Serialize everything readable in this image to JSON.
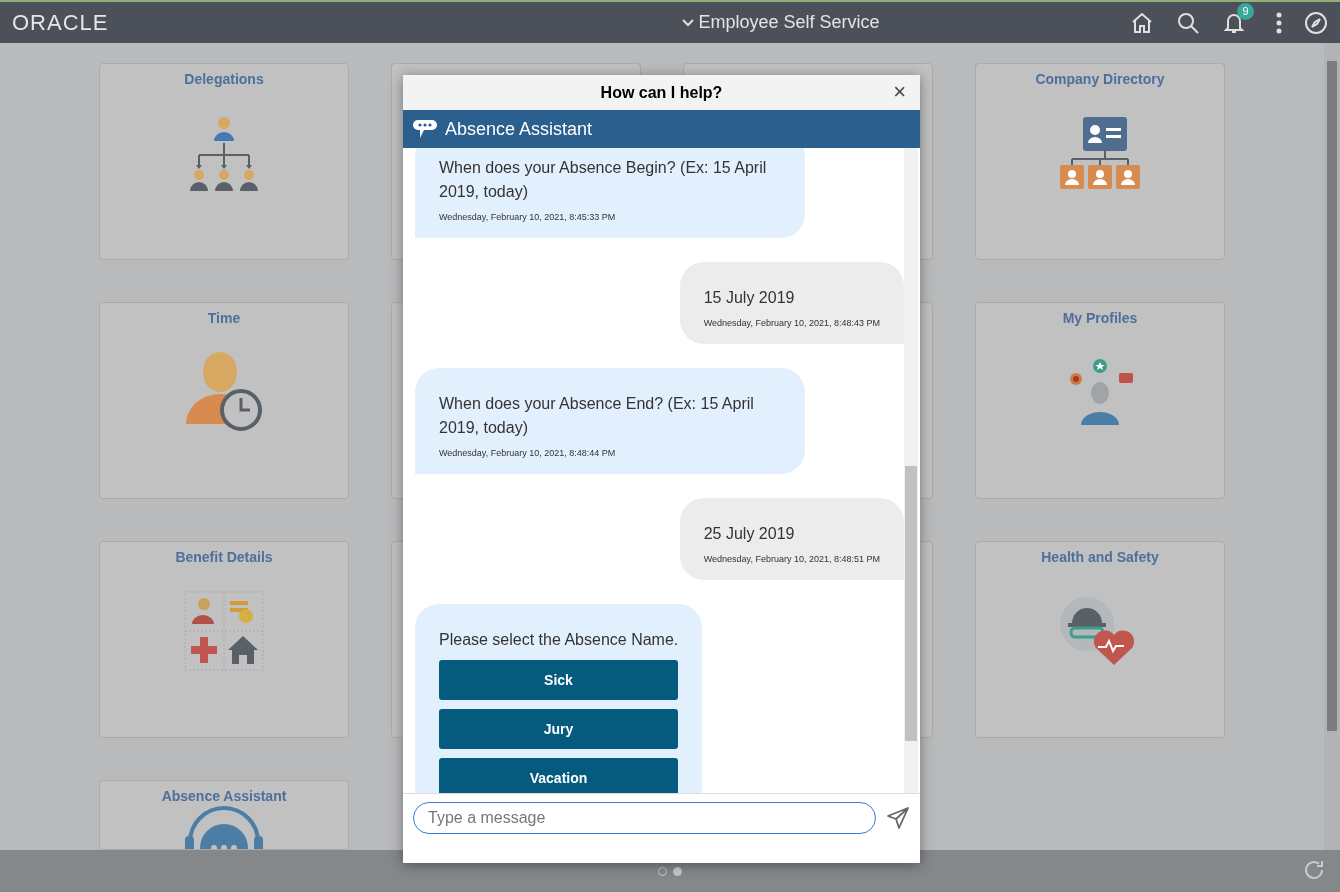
{
  "header": {
    "logo": "ORACLE",
    "title": "Employee Self Service",
    "notification_count": "9"
  },
  "tiles": [
    {
      "kind": "delegations",
      "title": "Delegations"
    },
    {
      "kind": "covered"
    },
    {
      "kind": "covered"
    },
    {
      "kind": "directory",
      "title": "Company Directory"
    },
    {
      "kind": "time",
      "title": "Time"
    },
    {
      "kind": "covered"
    },
    {
      "kind": "covered"
    },
    {
      "kind": "profiles",
      "title": "My Profiles"
    },
    {
      "kind": "benefits",
      "title": "Benefit Details"
    },
    {
      "kind": "covered"
    },
    {
      "kind": "covered"
    },
    {
      "kind": "health",
      "title": "Health and Safety"
    },
    {
      "kind": "assistant",
      "title": "Absence Assistant"
    }
  ],
  "chat": {
    "title": "How can I help?",
    "close": "×",
    "bot_name": "Absence Assistant",
    "messages": [
      {
        "kind": "bot",
        "text": "When does your Absence Begin? (Ex: 15 April 2019, today)",
        "time": "Wednesday, February 10, 2021, 8:45:33 PM"
      },
      {
        "kind": "user",
        "text": "15 July 2019",
        "time": "Wednesday, February 10, 2021, 8:48:43 PM"
      },
      {
        "kind": "bot",
        "text": "When does your Absence End? (Ex: 15 April 2019, today)",
        "time": "Wednesday, February 10, 2021, 8:48:44 PM"
      },
      {
        "kind": "user",
        "text": "25 July 2019",
        "time": "Wednesday, February 10, 2021, 8:48:51 PM"
      },
      {
        "kind": "bot",
        "text": "Please select the Absence Name.",
        "options": [
          "Sick",
          "Jury",
          "Vacation"
        ]
      }
    ],
    "input": {
      "placeholder": "Type a message"
    }
  },
  "pager": [
    {
      "selected": false
    },
    {
      "selected": true
    }
  ]
}
